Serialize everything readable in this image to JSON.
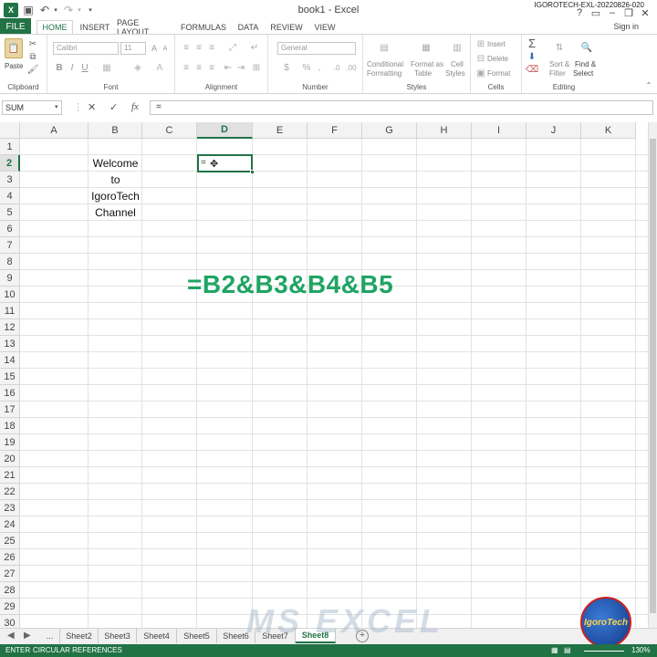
{
  "window": {
    "title": "book1 - Excel",
    "watermark_top": "IGOROTECH-EXL-20220826-020",
    "help": "?",
    "sign_in": "Sign in"
  },
  "ribbon_tabs": [
    {
      "label": "FILE"
    },
    {
      "label": "HOME"
    },
    {
      "label": "INSERT"
    },
    {
      "label": "PAGE LAYOUT"
    },
    {
      "label": "FORMULAS"
    },
    {
      "label": "DATA"
    },
    {
      "label": "REVIEW"
    },
    {
      "label": "VIEW"
    }
  ],
  "ribbon": {
    "clipboard": {
      "label": "Clipboard",
      "paste": "Paste"
    },
    "font": {
      "label": "Font",
      "font_name": "Calibri",
      "font_size": "11",
      "bold": "B",
      "italic": "I",
      "underline": "U"
    },
    "alignment": {
      "label": "Alignment"
    },
    "number": {
      "label": "Number",
      "format": "General",
      "currency": "$",
      "percent": "%"
    },
    "styles": {
      "label": "Styles",
      "conditional_1": "Conditional",
      "conditional_2": "Formatting",
      "format_table_1": "Format as",
      "format_table_2": "Table",
      "cell_styles_1": "Cell",
      "cell_styles_2": "Styles"
    },
    "cells": {
      "label": "Cells",
      "insert": "Insert",
      "delete": "Delete",
      "format": "Format"
    },
    "editing": {
      "label": "Editing",
      "sort_1": "Sort &",
      "sort_2": "Filter",
      "find_1": "Find &",
      "find_2": "Select"
    }
  },
  "formula_bar": {
    "name_box": "SUM",
    "cancel": "✕",
    "enter": "✓",
    "fx": "fx",
    "value": "="
  },
  "columns": [
    "A",
    "B",
    "C",
    "D",
    "E",
    "F",
    "G",
    "H",
    "I",
    "J",
    "K"
  ],
  "rows": [
    "1",
    "2",
    "3",
    "4",
    "5",
    "6",
    "7",
    "8",
    "9",
    "10",
    "11",
    "12",
    "13",
    "14",
    "15",
    "16",
    "17",
    "18",
    "19",
    "20",
    "21",
    "22",
    "23",
    "24",
    "25",
    "26",
    "27",
    "28",
    "29",
    "30"
  ],
  "active_cell": {
    "column": "D",
    "row": "2",
    "content": "="
  },
  "cells": {
    "B2": "Welcome",
    "B3": "to",
    "B4": "IgoroTech",
    "B5": "Channel"
  },
  "overlay_formula": "=B2&B3&B4&B5",
  "sheet_tabs": [
    {
      "label": "..."
    },
    {
      "label": "Sheet2"
    },
    {
      "label": "Sheet3"
    },
    {
      "label": "Sheet4"
    },
    {
      "label": "Sheet5"
    },
    {
      "label": "Sheet6"
    },
    {
      "label": "Sheet7"
    },
    {
      "label": "Sheet8"
    }
  ],
  "active_sheet": "Sheet8",
  "status": {
    "mode": "ENTER",
    "message": "CIRCULAR REFERENCES",
    "zoom": "130%"
  },
  "watermark": "MS EXCEL",
  "logo_text": "IgoroTech",
  "colors": {
    "excel_green": "#217346",
    "overlay_green": "#1fa463"
  }
}
